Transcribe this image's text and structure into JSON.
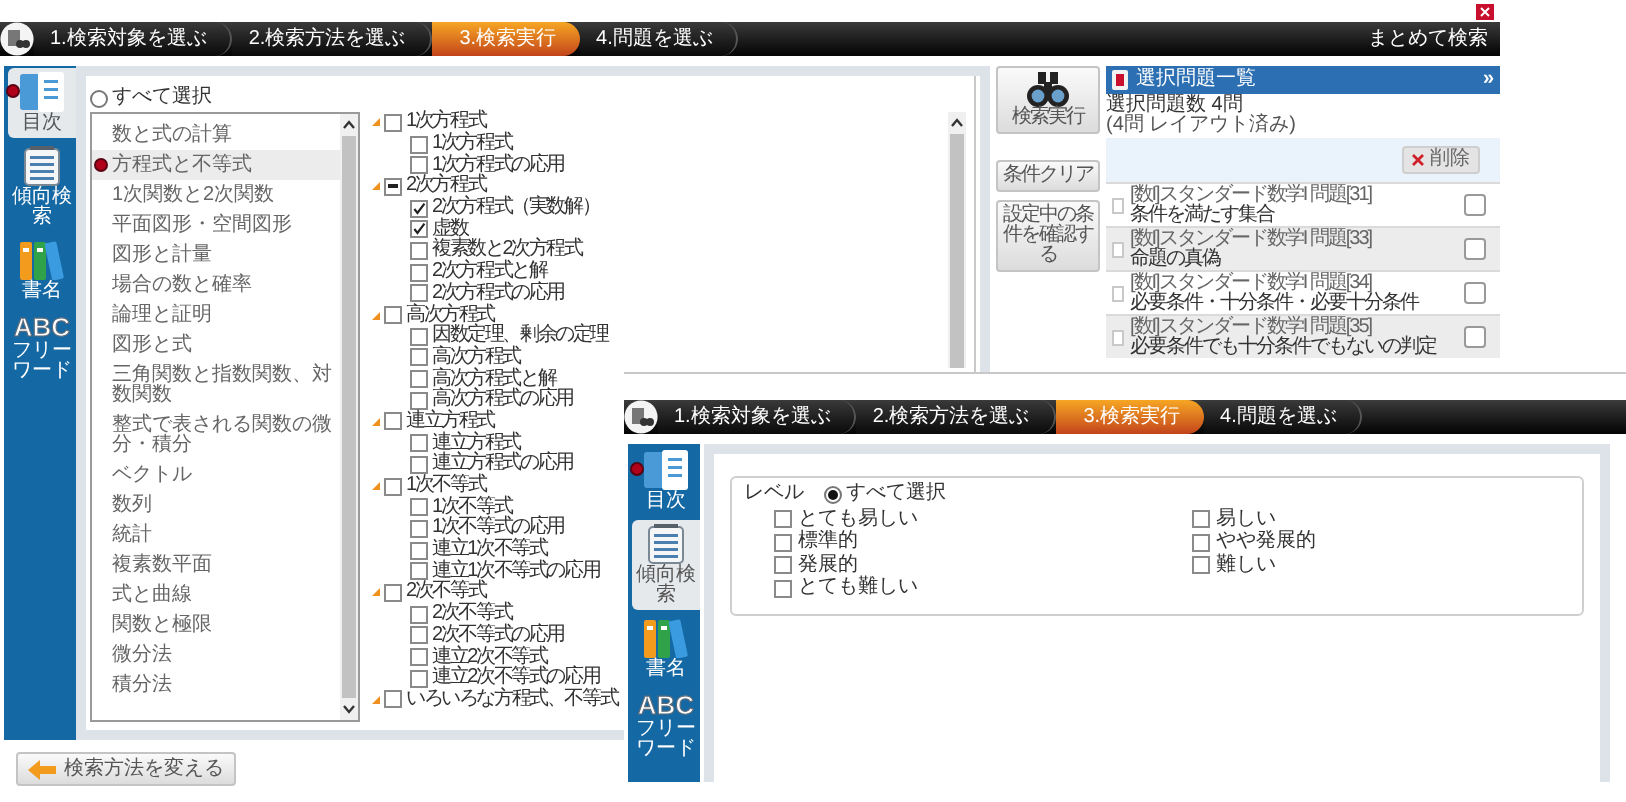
{
  "main_window": {
    "steps": [
      {
        "label": "1.検索対象を選ぶ",
        "selected": false
      },
      {
        "label": "2.検索方法を選ぶ",
        "selected": false
      },
      {
        "label": "3.検索実行",
        "selected": true
      },
      {
        "label": "4.問題を選ぶ",
        "selected": false
      }
    ],
    "batch_search": "まとめて検索",
    "sidebar": [
      {
        "kind": "book",
        "label": "目次",
        "selected": true,
        "marked": true
      },
      {
        "kind": "notepad",
        "label": "傾向検索",
        "selected": false,
        "marked": false
      },
      {
        "kind": "books",
        "label": "書名",
        "selected": false,
        "marked": false
      },
      {
        "kind": "abc",
        "logo_text": "ABC",
        "label": "フリーワード",
        "selected": false,
        "marked": false
      }
    ],
    "select_all": {
      "label": "すべて選択",
      "selected": false
    },
    "units": [
      {
        "label": "数と式の計算",
        "selected": false,
        "marked": false
      },
      {
        "label": "方程式と不等式",
        "selected": true,
        "marked": true
      },
      {
        "label": "1次関数と2次関数",
        "selected": false,
        "marked": false
      },
      {
        "label": "平面図形・空間図形",
        "selected": false,
        "marked": false
      },
      {
        "label": "図形と計量",
        "selected": false,
        "marked": false
      },
      {
        "label": "場合の数と確率",
        "selected": false,
        "marked": false
      },
      {
        "label": "論理と証明",
        "selected": false,
        "marked": false
      },
      {
        "label": "図形と式",
        "selected": false,
        "marked": false
      },
      {
        "label": "三角関数と指数関数、対数関数",
        "selected": false,
        "marked": false
      },
      {
        "label": "整式で表される関数の微分・積分",
        "selected": false,
        "marked": false
      },
      {
        "label": "ベクトル",
        "selected": false,
        "marked": false
      },
      {
        "label": "数列",
        "selected": false,
        "marked": false
      },
      {
        "label": "統計",
        "selected": false,
        "marked": false
      },
      {
        "label": "複素数平面",
        "selected": false,
        "marked": false
      },
      {
        "label": "式と曲線",
        "selected": false,
        "marked": false
      },
      {
        "label": "関数と極限",
        "selected": false,
        "marked": false
      },
      {
        "label": "微分法",
        "selected": false,
        "marked": false
      },
      {
        "label": "積分法",
        "selected": false,
        "marked": false
      }
    ],
    "topics": [
      {
        "label": "1次方程式",
        "expanded": true,
        "partial": false,
        "children": [
          {
            "label": "1次方程式",
            "checked": false
          },
          {
            "label": "1次方程式の応用",
            "checked": false
          }
        ]
      },
      {
        "label": "2次方程式",
        "expanded": true,
        "partial": true,
        "children": [
          {
            "label": "2次方程式（実数解）",
            "checked": true
          },
          {
            "label": "虚数",
            "checked": true
          },
          {
            "label": "複素数と2次方程式",
            "checked": false
          },
          {
            "label": "2次方程式と解",
            "checked": false
          },
          {
            "label": "2次方程式の応用",
            "checked": false
          }
        ]
      },
      {
        "label": "高次方程式",
        "expanded": true,
        "partial": false,
        "children": [
          {
            "label": "因数定理、剰余の定理",
            "checked": false
          },
          {
            "label": "高次方程式",
            "checked": false
          },
          {
            "label": "高次方程式と解",
            "checked": false
          },
          {
            "label": "高次方程式の応用",
            "checked": false
          }
        ]
      },
      {
        "label": "連立方程式",
        "expanded": true,
        "partial": false,
        "children": [
          {
            "label": "連立方程式",
            "checked": false
          },
          {
            "label": "連立方程式の応用",
            "checked": false
          }
        ]
      },
      {
        "label": "1次不等式",
        "expanded": true,
        "partial": false,
        "children": [
          {
            "label": "1次不等式",
            "checked": false
          },
          {
            "label": "1次不等式の応用",
            "checked": false
          },
          {
            "label": "連立1次不等式",
            "checked": false
          },
          {
            "label": "連立1次不等式の応用",
            "checked": false
          }
        ]
      },
      {
        "label": "2次不等式",
        "expanded": true,
        "partial": false,
        "children": [
          {
            "label": "2次不等式",
            "checked": false
          },
          {
            "label": "2次不等式の応用",
            "checked": false
          },
          {
            "label": "連立2次不等式",
            "checked": false
          },
          {
            "label": "連立2次不等式の応用",
            "checked": false
          }
        ]
      },
      {
        "label": "いろいろな方程式、不等式",
        "expanded": true,
        "partial": false
      }
    ],
    "actions": [
      {
        "kind": "search",
        "label": "検索実行"
      },
      {
        "kind": "text",
        "label": "条件クリア"
      },
      {
        "kind": "text",
        "label": "設定中の条件を確認する"
      }
    ],
    "selected_panel": {
      "title": "選択問題一覧",
      "collapse": "»",
      "count": "選択問題数 4問",
      "layout_note": "(4問 レイアウト済み)",
      "delete": "削除",
      "items": [
        {
          "source": "[数I]スタンダード数学I 問題[31]",
          "title": "条件を満たす集合",
          "checked": false
        },
        {
          "source": "[数I]スタンダード数学I 問題[33]",
          "title": "命題の真偽",
          "checked": false
        },
        {
          "source": "[数I]スタンダード数学I 問題[34]",
          "title": "必要条件・十分条件・必要十分条件",
          "checked": false
        },
        {
          "source": "[数I]スタンダード数学I 問題[35]",
          "title": "必要条件でも十分条件でもないの判定",
          "checked": false
        }
      ]
    },
    "back_button": "検索方法を変える"
  },
  "level_window": {
    "steps": [
      {
        "label": "1.検索対象を選ぶ",
        "selected": false
      },
      {
        "label": "2.検索方法を選ぶ",
        "selected": false
      },
      {
        "label": "3.検索実行",
        "selected": true
      },
      {
        "label": "4.問題を選ぶ",
        "selected": false
      }
    ],
    "sidebar": [
      {
        "kind": "book",
        "label": "目次",
        "selected": false,
        "marked": true
      },
      {
        "kind": "notepad",
        "label": "傾向検索",
        "selected": true,
        "marked": false
      },
      {
        "kind": "books",
        "label": "書名",
        "selected": false,
        "marked": false
      },
      {
        "kind": "abc",
        "logo_text": "ABC",
        "label": "フリーワード",
        "selected": false,
        "marked": false
      }
    ],
    "level_label": "レベル",
    "select_all": {
      "label": "すべて選択",
      "selected": true
    },
    "options": [
      {
        "label": "とても易しい",
        "checked": false
      },
      {
        "label": "易しい",
        "checked": false
      },
      {
        "label": "標準的",
        "checked": false
      },
      {
        "label": "やや発展的",
        "checked": false
      },
      {
        "label": "発展的",
        "checked": false
      },
      {
        "label": "難しい",
        "checked": false
      },
      {
        "label": "とても難しい",
        "checked": false
      }
    ]
  }
}
